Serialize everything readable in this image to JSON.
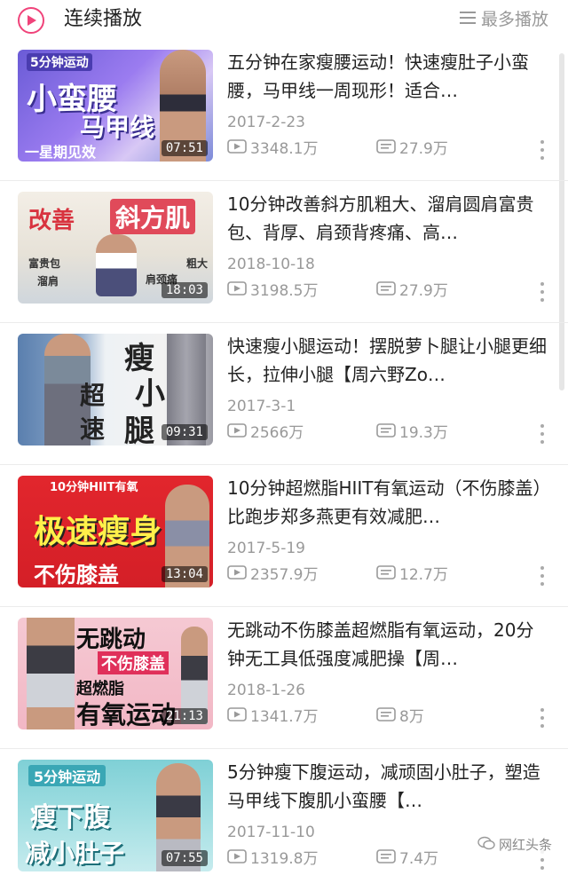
{
  "header": {
    "title": "连续播放",
    "more_label": "最多播放",
    "play_icon": "play-circle-icon",
    "menu_icon": "menu-lines-icon"
  },
  "items": [
    {
      "title": "五分钟在家瘦腰运动！快速瘦肚子小蛮腰，马甲线一周现形！适合…",
      "date": "2017-2-23",
      "views": "3348.1万",
      "comments": "27.9万",
      "duration": "07:51",
      "thumb_texts": [
        "5分钟运动",
        "小蛮腰",
        "马甲线",
        "一星期见效"
      ]
    },
    {
      "title": "10分钟改善斜方肌粗大、溜肩圆肩富贵包、背厚、肩颈背疼痛、高…",
      "date": "2018-10-18",
      "views": "3198.5万",
      "comments": "27.9万",
      "duration": "18:03",
      "thumb_texts": [
        "改善",
        "斜方肌",
        "富贵包",
        "溜肩",
        "粗大",
        "肩颈痛"
      ]
    },
    {
      "title": "快速瘦小腿运动！摆脱萝卜腿让小腿更细长，拉伸小腿【周六野Zo…",
      "date": "2017-3-1",
      "views": "2566万",
      "comments": "19.3万",
      "duration": "09:31",
      "thumb_texts": [
        "瘦",
        "小",
        "腿",
        "超",
        "速"
      ]
    },
    {
      "title": "10分钟超燃脂HIIT有氧运动（不伤膝盖）比跑步郑多燕更有效减肥…",
      "date": "2017-5-19",
      "views": "2357.9万",
      "comments": "12.7万",
      "duration": "13:04",
      "thumb_texts": [
        "10分钟HIIT有氧",
        "极速瘦身",
        "不伤膝盖"
      ]
    },
    {
      "title": "无跳动不伤膝盖超燃脂有氧运动，20分钟无工具低强度减肥操【周…",
      "date": "2018-1-26",
      "views": "1341.7万",
      "comments": "8万",
      "duration": "21:13",
      "thumb_texts": [
        "无跳动",
        "不伤膝盖",
        "超燃脂",
        "有氧运动"
      ]
    },
    {
      "title": "5分钟瘦下腹运动，减顽固小肚子，塑造马甲线下腹肌小蛮腰【…",
      "date": "2017-11-10",
      "views": "1319.8万",
      "comments": "7.4万",
      "duration": "07:55",
      "thumb_texts": [
        "5分钟运动",
        "瘦下腹",
        "减小肚子"
      ]
    }
  ],
  "watermark": "网红头条",
  "colors": {
    "accent": "#f0437a",
    "muted": "#999999"
  }
}
